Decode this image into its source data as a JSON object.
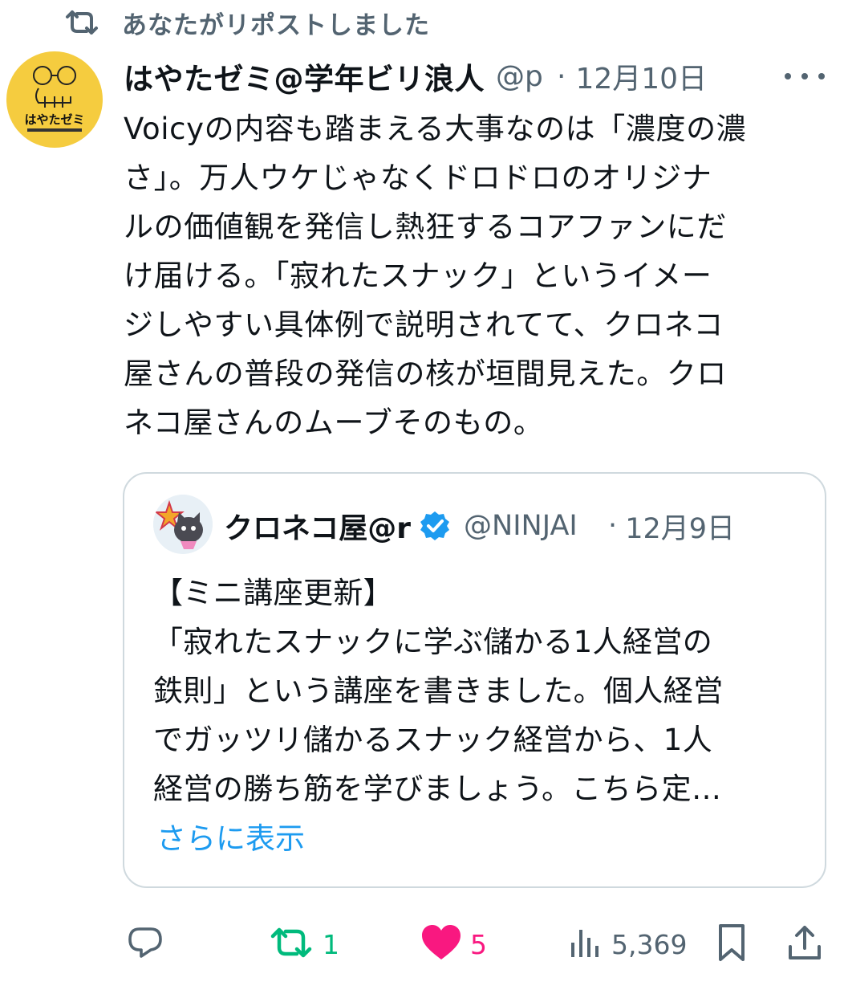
{
  "repost_notice": {
    "icon": "repost-icon",
    "text": "あなたがリポストしました"
  },
  "tweet": {
    "author_name": "はやたゼミ@学年ビリ浪人",
    "handle": "@p",
    "separator": "·",
    "date": "12月10日",
    "avatar_logo_text": "はやたゼミ",
    "body_lines": [
      "Voicyの内容も踏まえる大事なのは「濃度の濃",
      "さ」。万人ウケじゃなくドロドロのオリジナ",
      "ルの価値観を発信し熱狂するコアファンにだ",
      "け届ける。「寂れたスナック」というイメー",
      "ジしやすい具体例で説明されてて、クロネコ",
      "屋さんの普段の発信の核が垣間見えた。クロ",
      "ネコ屋さんのムーブそのもの。"
    ]
  },
  "quote": {
    "author_name": "クロネコ屋@r",
    "verified_icon": "verified-badge-icon",
    "handle": "@NINJAI",
    "separator": "·",
    "date": "12月9日",
    "body_lines": [
      "【ミニ講座更新】",
      "「寂れたスナックに学ぶ儲かる1人経営の",
      "鉄則」という講座を書きました。個人経営",
      "でガッツリ儲かるスナック経営から、1人",
      "経営の勝ち筋を学びましょう。こちら定…"
    ],
    "show_more": "さらに表示"
  },
  "actions": {
    "reply": {
      "icon": "reply-icon",
      "count": ""
    },
    "retweet": {
      "icon": "retweet-icon",
      "count": "1",
      "color": "#00ba7c"
    },
    "like": {
      "icon": "heart-icon",
      "count": "5",
      "color": "#f91880"
    },
    "views": {
      "icon": "views-icon",
      "count": "5,369"
    },
    "bookmark": {
      "icon": "bookmark-icon"
    },
    "share": {
      "icon": "share-icon"
    }
  },
  "colors": {
    "secondary_text": "#536471",
    "link": "#1d9bf0",
    "border": "#cfd9de",
    "avatar_bg": "#f5cc3f"
  }
}
